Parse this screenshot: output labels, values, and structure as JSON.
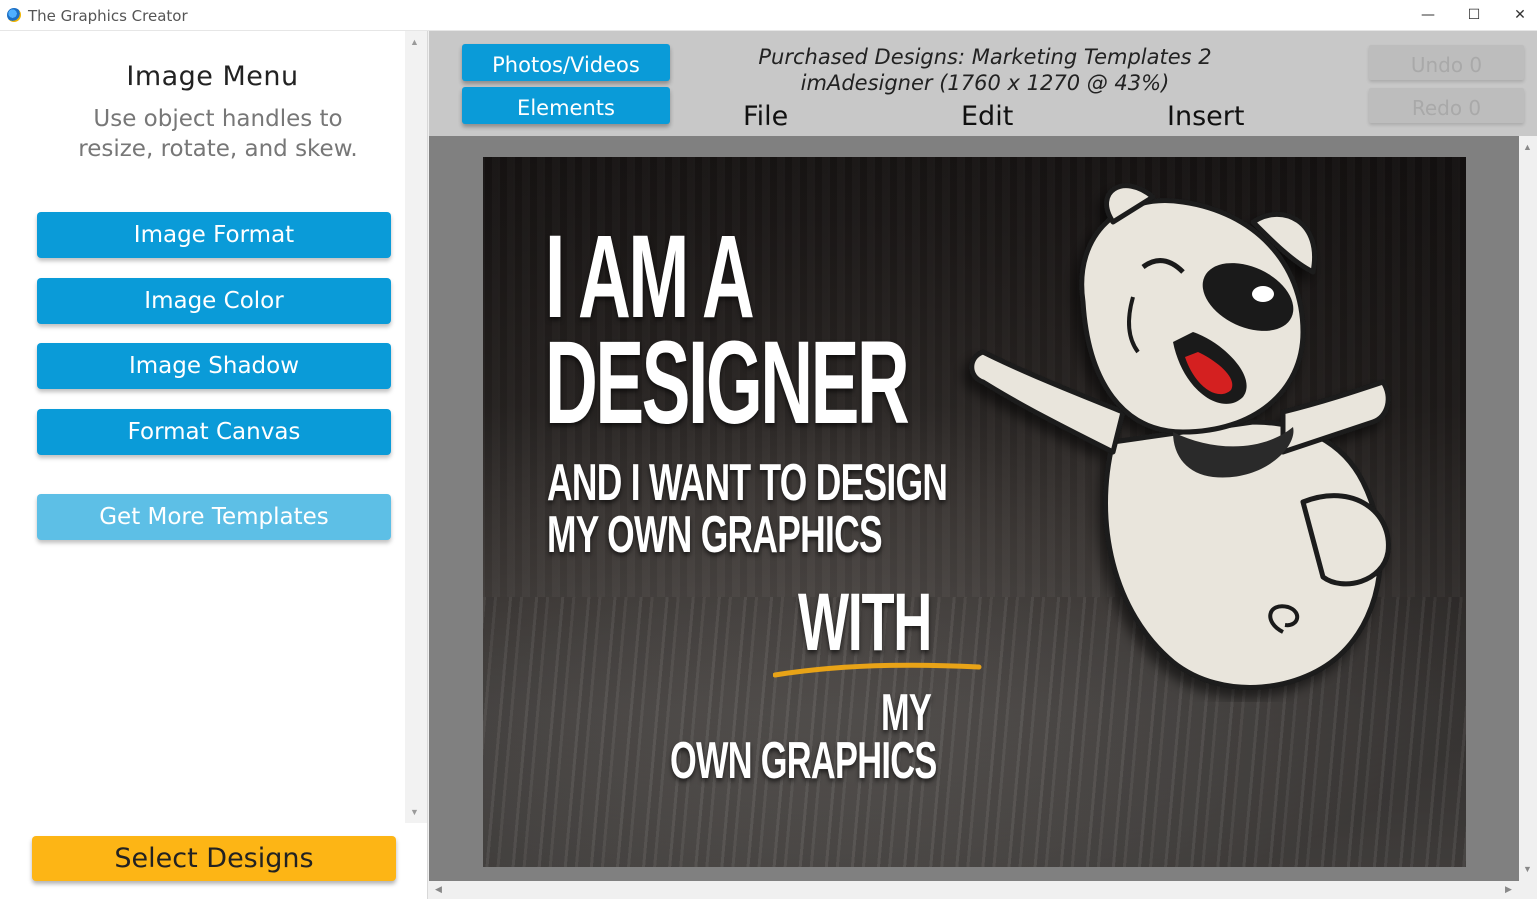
{
  "window": {
    "title": "The Graphics Creator",
    "minimize": "—",
    "maximize": "☐",
    "close": "✕"
  },
  "left_panel": {
    "title": "Image Menu",
    "hint": "Use object handles to resize, rotate, and skew.",
    "buttons": [
      {
        "label": "Image Format"
      },
      {
        "label": "Image Color"
      },
      {
        "label": "Image Shadow"
      },
      {
        "label": "Format Canvas"
      }
    ],
    "more_templates_label": "Get More Templates",
    "select_designs_label": "Select Designs"
  },
  "toolbar": {
    "photos_videos_label": "Photos/Videos",
    "elements_label": "Elements",
    "doc_title_line1": "Purchased Designs: Marketing Templates 2",
    "doc_title_line2": "imAdesigner (1760 x 1270 @ 43%)",
    "menus": [
      "File",
      "Edit",
      "Insert"
    ],
    "undo_label": "Undo 0",
    "redo_label": "Redo 0"
  },
  "design": {
    "line1": "I AM A",
    "line2": "DESIGNER",
    "line3": "AND I WANT TO DESIGN",
    "line4": "MY OWN GRAPHICS",
    "line5": "WITH",
    "line6": "MY",
    "line7": "OWN GRAPHICS",
    "accent_color": "#e8a317"
  },
  "colors": {
    "primary_button": "#0a9bd8",
    "light_button": "#5dbfe6",
    "select_button": "#fdb515",
    "toolbar_bg": "#c8c8c8",
    "canvas_bg": "#808080"
  }
}
